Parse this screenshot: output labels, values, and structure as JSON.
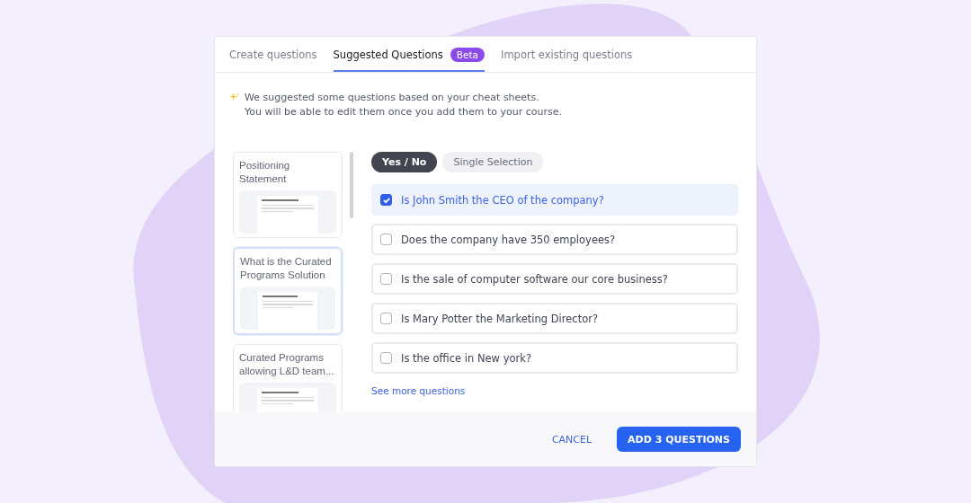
{
  "tabs": [
    {
      "label": "Create questions",
      "selected": false
    },
    {
      "label": "Suggested Questions",
      "selected": true,
      "badge": "Beta"
    },
    {
      "label": "Import existing questions",
      "selected": false
    }
  ],
  "intro": [
    "We suggested some questions based on your cheat sheets.",
    "You will be able to edit them once you add them to your course."
  ],
  "sheets": [
    {
      "title": "Positioning Statement",
      "selected": false
    },
    {
      "title": "What is the Curated Programs Solution",
      "selected": true
    },
    {
      "title": "Curated Programs allowing L&D team...",
      "selected": false
    }
  ],
  "question_types": [
    {
      "label": "Yes / No",
      "selected": true
    },
    {
      "label": "Single Selection",
      "selected": false
    }
  ],
  "questions": [
    {
      "text": "Is John Smith the CEO of the company?",
      "checked": true
    },
    {
      "text": "Does the company have 350 employees?",
      "checked": false
    },
    {
      "text": "Is the sale of computer software our core business?",
      "checked": false
    },
    {
      "text": "Is Mary Potter the Marketing Director?",
      "checked": false
    },
    {
      "text": "Is the office in New york?",
      "checked": false
    }
  ],
  "see_more": "See more questions",
  "footer": {
    "cancel": "CANCEL",
    "confirm": "ADD 3 QUESTIONS"
  }
}
